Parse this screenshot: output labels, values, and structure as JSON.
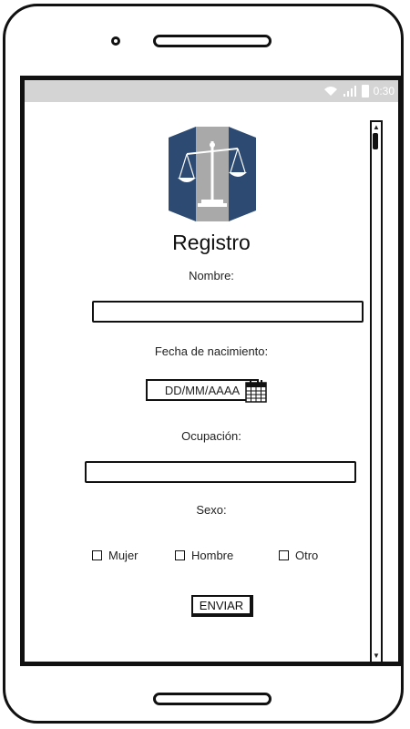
{
  "status_bar": {
    "time": "0:30"
  },
  "form": {
    "title": "Registro",
    "name_label": "Nombre:",
    "name_value": "",
    "birthdate_label": "Fecha de nacimiento:",
    "birthdate_placeholder": "DD/MM/AAAA",
    "occupation_label": "Ocupación:",
    "occupation_value": "",
    "sex_label": "Sexo:",
    "sex_options": [
      {
        "label": "Mujer",
        "checked": false
      },
      {
        "label": "Hombre",
        "checked": false
      },
      {
        "label": "Otro",
        "checked": false
      }
    ],
    "submit_label": "ENVIAR"
  },
  "icons": {
    "logo": "scales-of-justice-icon",
    "calendar": "calendar-icon",
    "wifi": "wifi-icon",
    "signal": "signal-icon",
    "battery": "battery-icon"
  },
  "colors": {
    "logo_blue": "#2c4a72",
    "logo_gray": "#a9a9a9",
    "status_bar": "#d4d4d4"
  }
}
